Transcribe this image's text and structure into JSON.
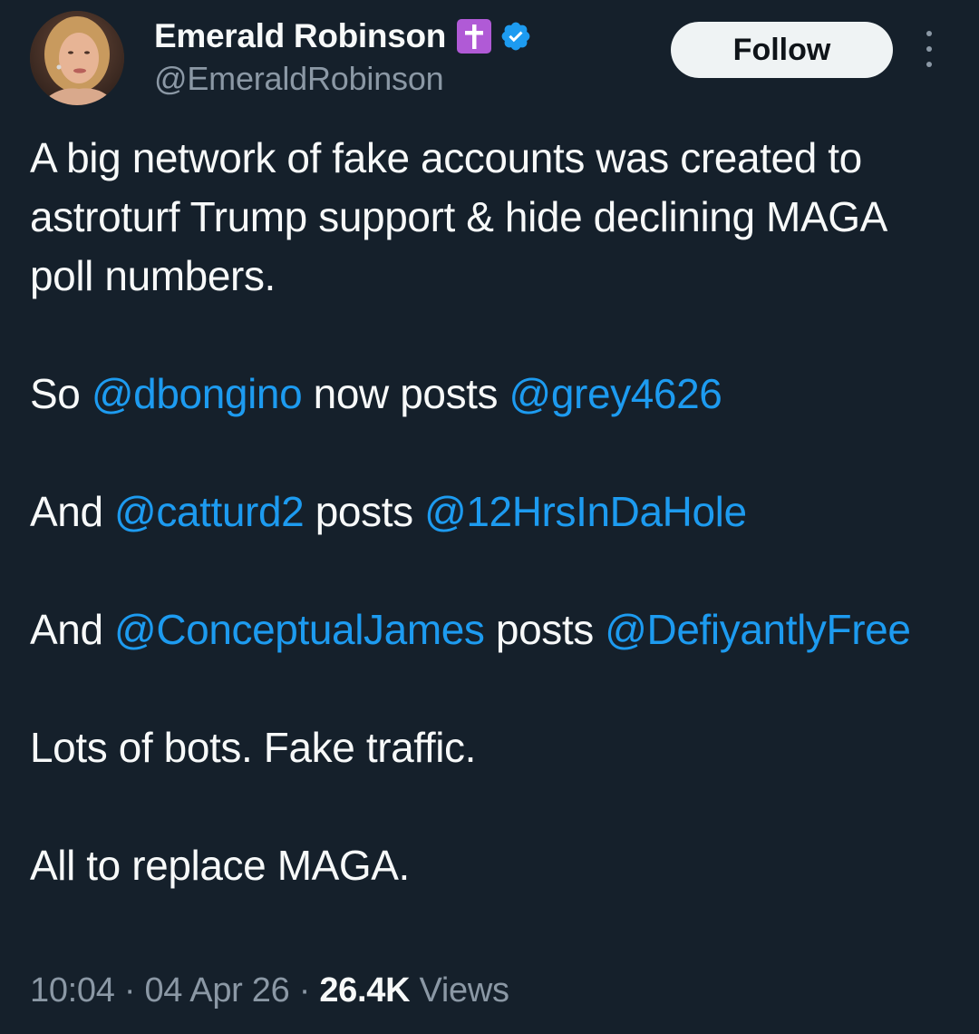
{
  "author": {
    "display_name": "Emerald Robinson",
    "handle": "@EmeraldRobinson",
    "badges": [
      "latin-cross-emoji-icon",
      "verified-badge-icon"
    ]
  },
  "actions": {
    "follow_label": "Follow",
    "more_icon": "more-vertical-icon"
  },
  "tweet": {
    "p1": "A big network of fake accounts was created to astroturf Trump support & hide declining MAGA poll numbers.",
    "p2": {
      "t1": "So ",
      "m1": "@dbongino",
      "t2": " now posts ",
      "m2": "@grey4626"
    },
    "p3": {
      "t1": "And ",
      "m1": "@catturd2",
      "t2": " posts ",
      "m2": "@12HrsInDaHole"
    },
    "p4": {
      "t1": "And ",
      "m1": "@ConceptualJames",
      "t2": " posts ",
      "m2": "@DefiyantlyFree"
    },
    "p5": "Lots of bots. Fake traffic.",
    "p6": "All to replace MAGA."
  },
  "meta": {
    "time": "10:04",
    "separator": " · ",
    "date": "04 Apr 26",
    "views_count": "26.4K",
    "views_label": " Views"
  },
  "colors": {
    "background": "#15202b",
    "text": "#f7f9f9",
    "secondary": "#8b98a5",
    "link": "#1d9bf0",
    "cross_badge": "#b05ad6",
    "verified": "#1d9bf0"
  }
}
